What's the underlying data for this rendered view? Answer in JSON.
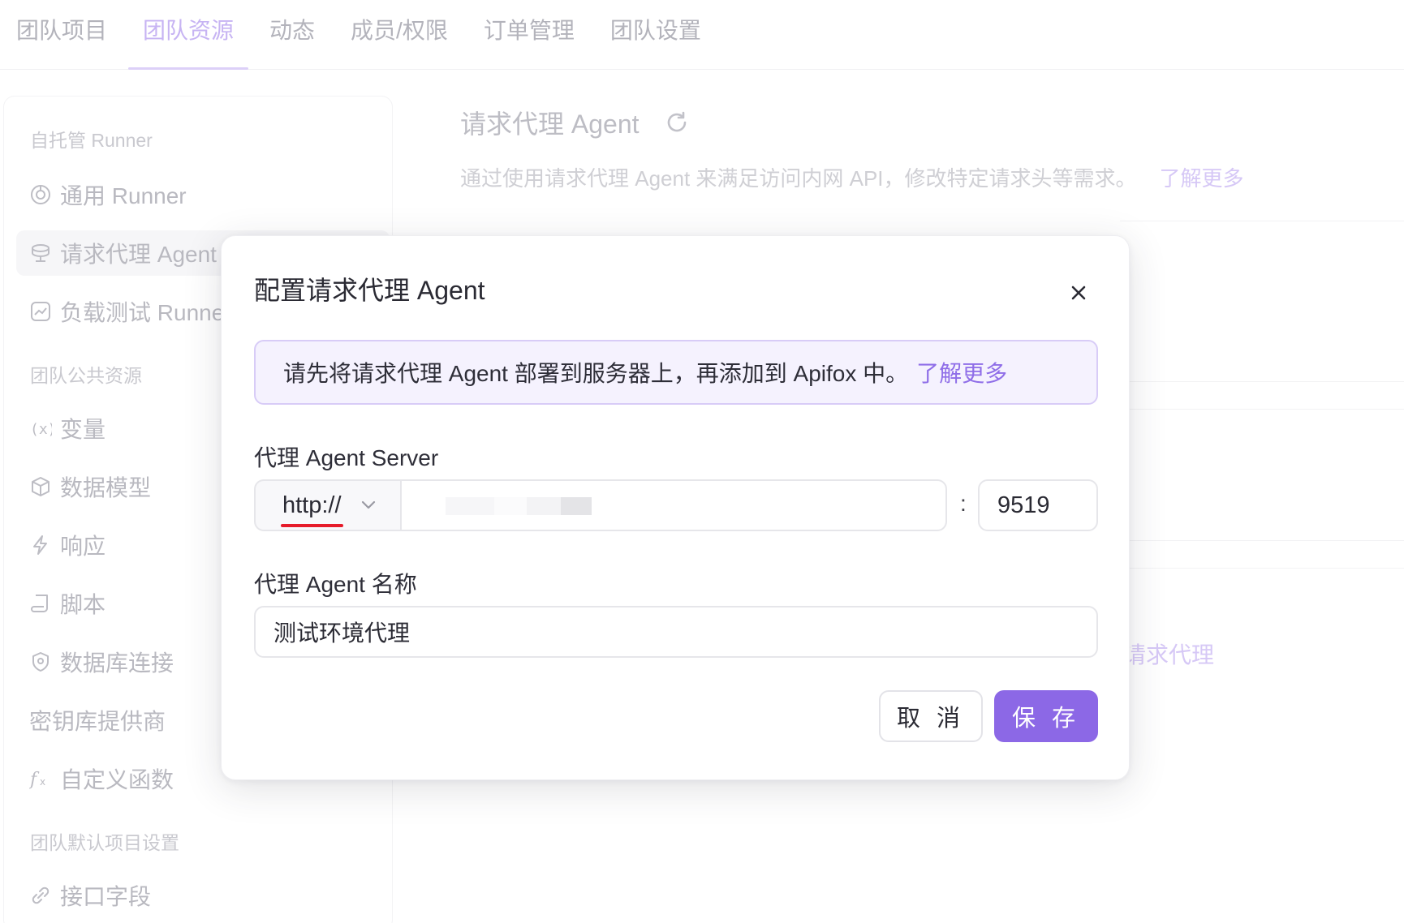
{
  "topnav": {
    "tabs": [
      {
        "label": "团队项目"
      },
      {
        "label": "团队资源"
      },
      {
        "label": "动态"
      },
      {
        "label": "成员/权限"
      },
      {
        "label": "订单管理"
      },
      {
        "label": "团队设置"
      }
    ],
    "active": "团队资源"
  },
  "sidebar": {
    "group_runner": "自托管 Runner",
    "item_general_runner": "通用 Runner",
    "item_proxy_agent": "请求代理 Agent",
    "item_load_test": "负载测试 Runner",
    "group_public": "团队公共资源",
    "item_variables": "变量",
    "item_data_model": "数据模型",
    "item_response": "响应",
    "item_script": "脚本",
    "item_db": "数据库连接",
    "item_vault": "密钥库提供商",
    "item_functions": "自定义函数",
    "group_defaults": "团队默认项目设置",
    "item_fields": "接口字段"
  },
  "main": {
    "title": "请求代理 Agent",
    "description": "通过使用请求代理 Agent 来满足访问内网 API，修改特定请求头等需求。",
    "learn_more": "了解更多",
    "partial_link": "请求代理"
  },
  "modal": {
    "title": "配置请求代理 Agent",
    "notice_text": "请先将请求代理 Agent 部署到服务器上，再添加到 Apifox 中。",
    "notice_link": "了解更多",
    "server_label": "代理 Agent Server",
    "protocol": "http://",
    "host": "",
    "colon": ":",
    "port": "9519",
    "name_label": "代理 Agent 名称",
    "name_value": "测试环境代理",
    "cancel_label": "取 消",
    "save_label": "保 存"
  },
  "colors": {
    "accent": "#8c68e6",
    "notice_bg": "#f5f2fe",
    "annotation_underline": "#e61b2a"
  }
}
